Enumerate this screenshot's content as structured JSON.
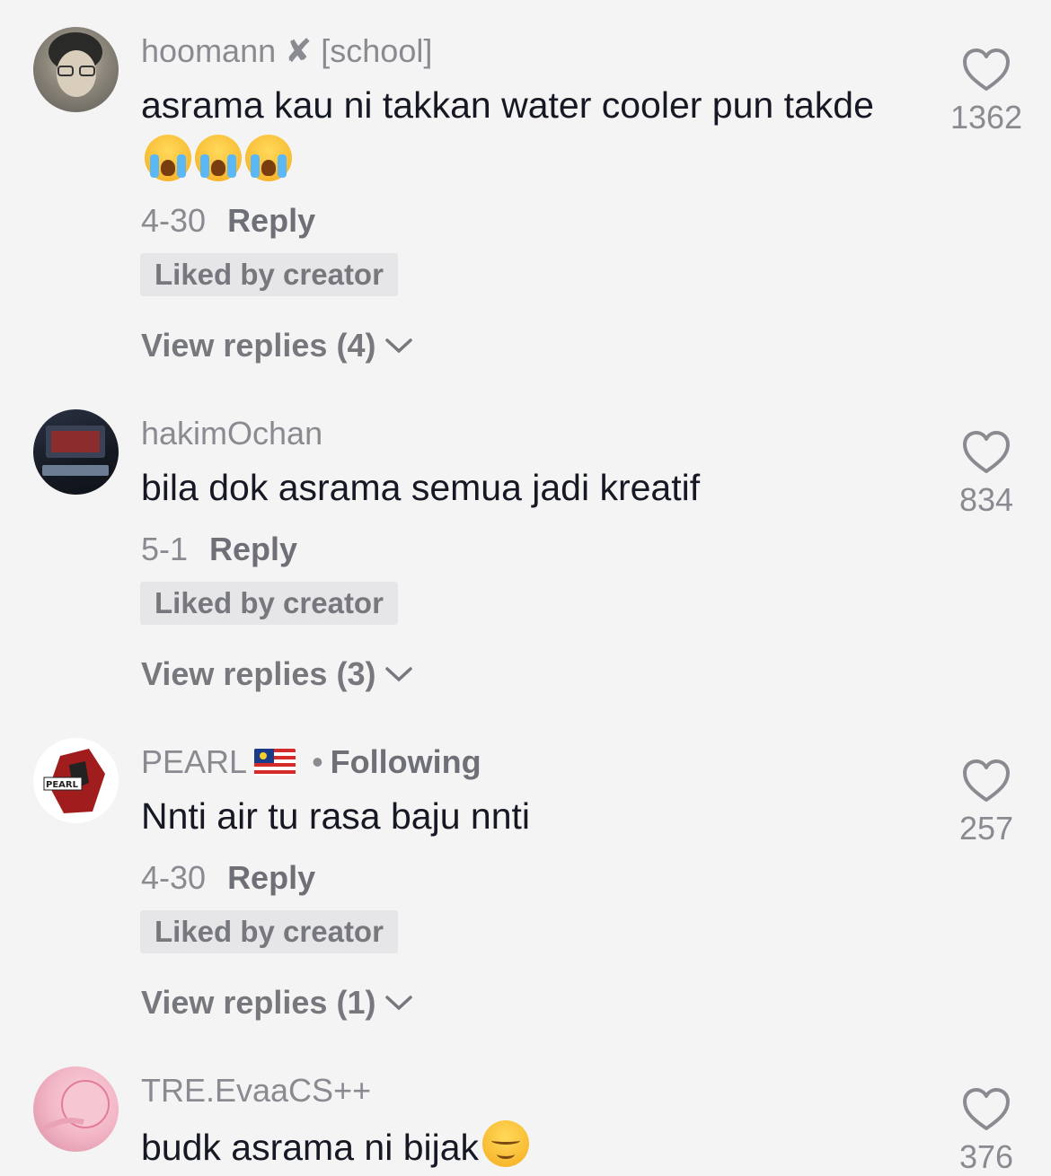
{
  "comments": [
    {
      "username": "hoomann ✘ [school]",
      "text": "asrama kau ni takkan water cooler pun takde",
      "emoji_after_text": [
        "loudly-crying-face",
        "loudly-crying-face",
        "loudly-crying-face"
      ],
      "date": "4-30",
      "reply_label": "Reply",
      "liked_label": "Liked by creator",
      "view_replies": "View replies (4)",
      "likes": "1362",
      "avatar_colors": [
        "#5b5b56",
        "#c9c2b4"
      ]
    },
    {
      "username": "hakimOchan",
      "text": "bila dok asrama semua jadi kreatif",
      "date": "5-1",
      "reply_label": "Reply",
      "liked_label": "Liked by creator",
      "view_replies": "View replies (3)",
      "likes": "834",
      "avatar_colors": [
        "#1c2430",
        "#b83a3a"
      ]
    },
    {
      "username": "PEARL",
      "flag": "malaysia-flag",
      "separator": "•",
      "following_label": "Following",
      "text": "Nnti air tu rasa baju nnti",
      "date": "4-30",
      "reply_label": "Reply",
      "liked_label": "Liked by creator",
      "view_replies": "View replies (1)",
      "likes": "257",
      "avatar_colors": [
        "#a11d1d",
        "#222222"
      ],
      "avatar_text": "PEARL"
    },
    {
      "username": "TRE.EvaaCS++",
      "text": "budk asrama ni bijak",
      "emoji_after_text": [
        "relieved-face"
      ],
      "likes": "376",
      "avatar_colors": [
        "#f2b6c6",
        "#e88aa3"
      ]
    }
  ],
  "colors": {
    "background": "#f4f4f5",
    "text_primary": "#161823",
    "text_secondary": "#8a8b91",
    "badge_background": "#e6e6e8"
  }
}
